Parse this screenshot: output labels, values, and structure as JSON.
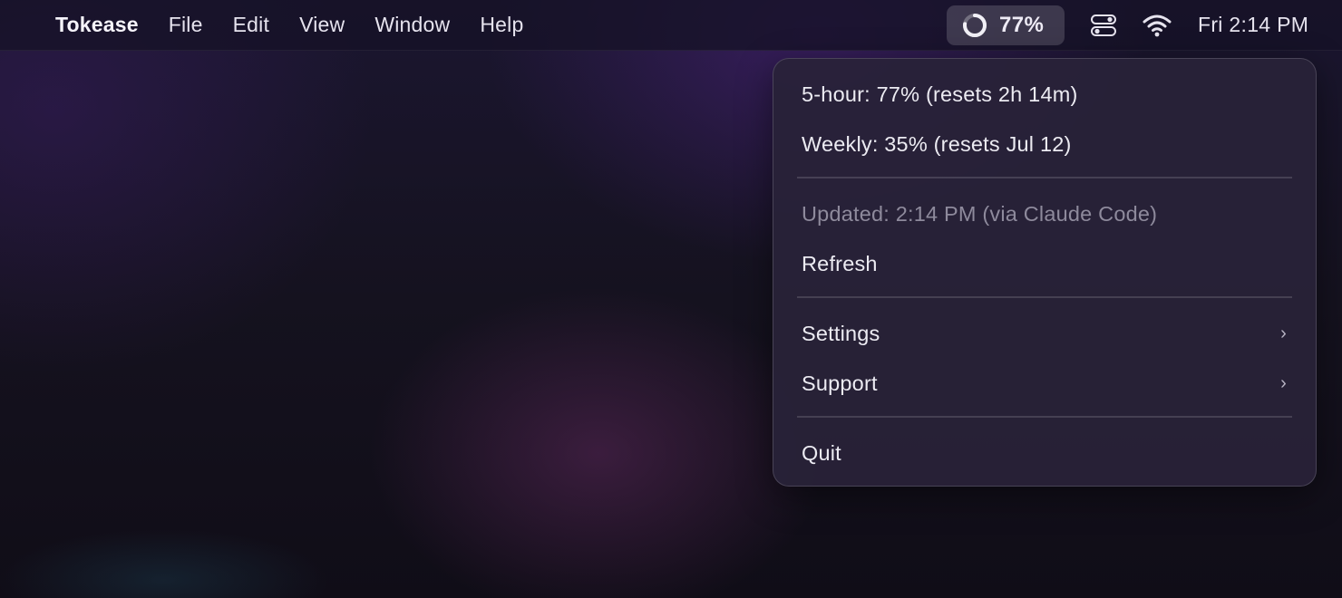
{
  "menubar": {
    "app_name": "Tokease",
    "menus": [
      "File",
      "Edit",
      "View",
      "Window",
      "Help"
    ],
    "usage_percent_label": "77%",
    "usage_fraction": 0.77,
    "clock": "Fri 2:14 PM",
    "icons": [
      "usage-ring-icon",
      "control-center-icon",
      "wifi-icon"
    ]
  },
  "dropdown": {
    "five_hour": "5-hour: 77% (resets 2h 14m)",
    "weekly": "Weekly: 35% (resets Jul 12)",
    "updated": "Updated: 2:14 PM (via Claude Code)",
    "refresh": "Refresh",
    "settings": "Settings",
    "support": "Support",
    "quit": "Quit",
    "submenu_glyph": "›"
  },
  "colors": {
    "menu_text": "#e6e3ee",
    "muted_text": "#8e8a9c",
    "pill_bg": "#4a4460"
  }
}
